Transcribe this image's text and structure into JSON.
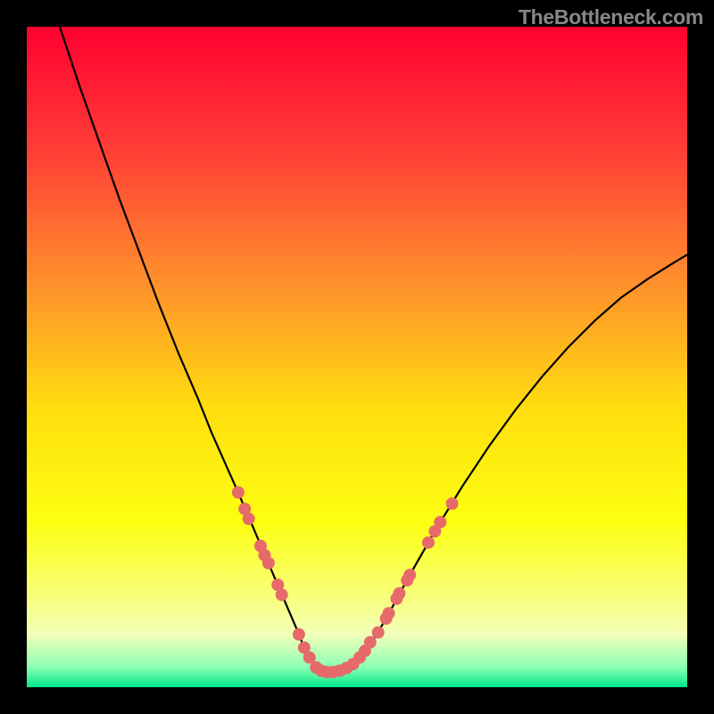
{
  "watermark": "TheBottleneck.com",
  "chart_data": {
    "type": "line",
    "title": "",
    "xlabel": "",
    "ylabel": "",
    "xlim": [
      0,
      100
    ],
    "ylim": [
      0,
      100
    ],
    "curve": {
      "name": "bottleneck-curve",
      "x": [
        5,
        8,
        11,
        14,
        17,
        20,
        23,
        26,
        28,
        30,
        32,
        33.5,
        35,
        36.5,
        38,
        39.5,
        41,
        42,
        43,
        44,
        45,
        47,
        49,
        51,
        53,
        55,
        58,
        62,
        66,
        70,
        74,
        78,
        82,
        86,
        90,
        94,
        98,
        100
      ],
      "y": [
        100,
        91,
        82.5,
        74,
        66,
        58,
        50.5,
        43.5,
        38.5,
        34,
        29.5,
        26,
        22.5,
        19,
        15.5,
        12,
        8.5,
        6,
        4,
        2.8,
        2.3,
        2.4,
        3.2,
        5.2,
        8,
        11.5,
        17,
        24,
        30.5,
        36.5,
        42,
        47,
        51.5,
        55.5,
        59,
        61.8,
        64.3,
        65.5
      ]
    },
    "scatter": {
      "name": "bottleneck-points",
      "color": "#E66A6A",
      "radius_px": 7,
      "points": [
        {
          "x": 32.0,
          "y": 29.5
        },
        {
          "x": 33.0,
          "y": 27.0
        },
        {
          "x": 33.6,
          "y": 25.5
        },
        {
          "x": 35.4,
          "y": 21.4
        },
        {
          "x": 36.0,
          "y": 20.0
        },
        {
          "x": 36.6,
          "y": 18.8
        },
        {
          "x": 38.0,
          "y": 15.5
        },
        {
          "x": 38.6,
          "y": 14.0
        },
        {
          "x": 41.2,
          "y": 8.0
        },
        {
          "x": 42.0,
          "y": 6.0
        },
        {
          "x": 42.8,
          "y": 4.5
        },
        {
          "x": 43.8,
          "y": 3.0
        },
        {
          "x": 44.6,
          "y": 2.5
        },
        {
          "x": 45.4,
          "y": 2.3
        },
        {
          "x": 46.4,
          "y": 2.3
        },
        {
          "x": 47.4,
          "y": 2.5
        },
        {
          "x": 48.4,
          "y": 2.9
        },
        {
          "x": 49.4,
          "y": 3.5
        },
        {
          "x": 50.4,
          "y": 4.5
        },
        {
          "x": 51.2,
          "y": 5.5
        },
        {
          "x": 52.0,
          "y": 6.8
        },
        {
          "x": 53.2,
          "y": 8.3
        },
        {
          "x": 54.4,
          "y": 10.4
        },
        {
          "x": 54.8,
          "y": 11.2
        },
        {
          "x": 56.0,
          "y": 13.4
        },
        {
          "x": 56.4,
          "y": 14.2
        },
        {
          "x": 57.6,
          "y": 16.2
        },
        {
          "x": 58.0,
          "y": 17.0
        },
        {
          "x": 60.8,
          "y": 21.9
        },
        {
          "x": 61.8,
          "y": 23.6
        },
        {
          "x": 62.6,
          "y": 25.0
        },
        {
          "x": 64.4,
          "y": 27.8
        }
      ]
    },
    "gradient_stops": [
      {
        "pct": 0,
        "color": "#FF0030"
      },
      {
        "pct": 18,
        "color": "#FF3B36"
      },
      {
        "pct": 38,
        "color": "#FF8D2D"
      },
      {
        "pct": 58,
        "color": "#FFDE0E"
      },
      {
        "pct": 75,
        "color": "#FDFF11"
      },
      {
        "pct": 86,
        "color": "#F8FF78"
      },
      {
        "pct": 92,
        "color": "#F2FFB8"
      },
      {
        "pct": 97,
        "color": "#8BFFB4"
      },
      {
        "pct": 100,
        "color": "#00E889"
      }
    ]
  }
}
